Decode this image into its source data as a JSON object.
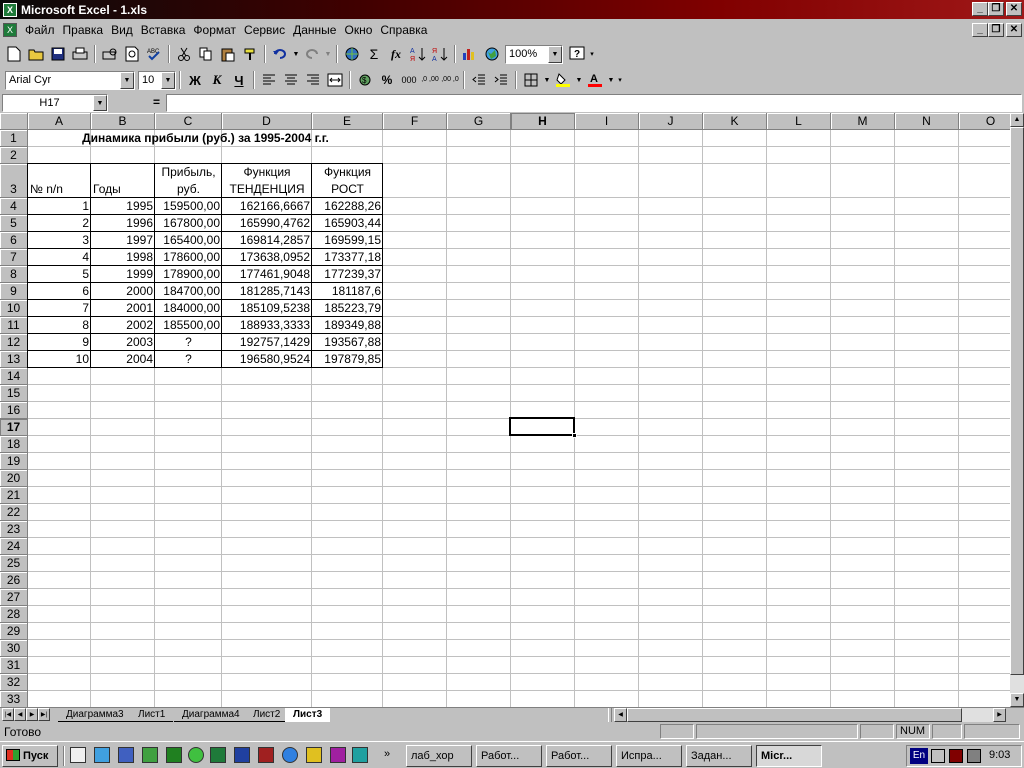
{
  "window": {
    "title": "Microsoft Excel - 1.xls",
    "app_icon": "excel-icon",
    "caption_buttons": [
      "_",
      "❐",
      "✕"
    ]
  },
  "menu": [
    "Файл",
    "Правка",
    "Вид",
    "Вставка",
    "Формат",
    "Сервис",
    "Данные",
    "Окно",
    "Справка"
  ],
  "standard_toolbar": {
    "zoom": "100%",
    "icons": [
      "new-icon",
      "open-icon",
      "save-icon",
      "print-icon",
      "print-preview-icon",
      "spelling-icon",
      "cut-icon",
      "copy-icon",
      "paste-icon",
      "format-painter-icon",
      "undo-icon",
      "redo-icon",
      "hyperlink-icon",
      "autosum-icon",
      "function-icon",
      "sort-asc-icon",
      "sort-desc-icon",
      "chart-wizard-icon",
      "map-icon",
      "help-icon"
    ],
    "autosum_glyph": "Σ",
    "function_glyph": "fx"
  },
  "formatting_toolbar": {
    "font": "Arial Cyr",
    "size": "10",
    "bold": "Ж",
    "italic": "К",
    "underline": "Ч",
    "percent": "%",
    "thousands": "000",
    "inc_decimal": ",0 ,00",
    "dec_decimal": ",00 ,0"
  },
  "formula_bar": {
    "name_box": "H17",
    "equals": "=",
    "content": ""
  },
  "columns": [
    {
      "label": "A"
    },
    {
      "label": "B"
    },
    {
      "label": "C"
    },
    {
      "label": "D"
    },
    {
      "label": "E"
    },
    {
      "label": "F"
    },
    {
      "label": "G"
    },
    {
      "label": "H"
    },
    {
      "label": "I"
    },
    {
      "label": "J"
    },
    {
      "label": "K"
    },
    {
      "label": "L"
    },
    {
      "label": "M"
    },
    {
      "label": "N"
    },
    {
      "label": "O"
    }
  ],
  "active_column": "H",
  "active_row": "17",
  "rows": [
    "1",
    "2",
    "3",
    "4",
    "5",
    "6",
    "7",
    "8",
    "9",
    "10",
    "11",
    "12",
    "13",
    "14",
    "15",
    "16",
    "17",
    "18",
    "19",
    "20",
    "21",
    "22",
    "23",
    "24",
    "25",
    "26",
    "27",
    "28",
    "29",
    "30",
    "31",
    "32",
    "33"
  ],
  "sheet": {
    "title": "Динамика прибыли (руб.) за 1995-2004 г.г.",
    "headers": {
      "a": "№ n/n",
      "b": "Годы",
      "c1": "Прибыль,",
      "c2": "руб.",
      "d1": "Функция",
      "d2": "ТЕНДЕНЦИЯ",
      "e1": "Функция",
      "e2": "РОСТ"
    },
    "data": [
      [
        "1",
        "1995",
        "159500,00",
        "162166,6667",
        "162288,26"
      ],
      [
        "2",
        "1996",
        "167800,00",
        "165990,4762",
        "165903,44"
      ],
      [
        "3",
        "1997",
        "165400,00",
        "169814,2857",
        "169599,15"
      ],
      [
        "4",
        "1998",
        "178600,00",
        "173638,0952",
        "173377,18"
      ],
      [
        "5",
        "1999",
        "178900,00",
        "177461,9048",
        "177239,37"
      ],
      [
        "6",
        "2000",
        "184700,00",
        "181285,7143",
        "181187,6"
      ],
      [
        "7",
        "2001",
        "184000,00",
        "185109,5238",
        "185223,79"
      ],
      [
        "8",
        "2002",
        "185500,00",
        "188933,3333",
        "189349,88"
      ],
      [
        "9",
        "2003",
        "?",
        "192757,1429",
        "193567,88"
      ],
      [
        "10",
        "2004",
        "?",
        "196580,9524",
        "197879,85"
      ]
    ]
  },
  "sheet_tabs": [
    "Диаграмма3",
    "Лист1",
    "Диаграмма4",
    "Лист2",
    "Лист3"
  ],
  "active_tab": "Лист3",
  "status": {
    "text": "Готово",
    "num": "NUM"
  },
  "taskbar": {
    "start": "Пуск",
    "tasks": [
      "лаб_хор",
      "Работ...",
      "Работ...",
      "Испра...",
      "Задан...",
      "Micr..."
    ],
    "active_task": "Micr...",
    "lang": "En",
    "clock": "9:03"
  },
  "colors": {
    "title_gradient_end": "#a01818",
    "face": "#c0c0c0",
    "excel_green": "#1f7a3a"
  }
}
